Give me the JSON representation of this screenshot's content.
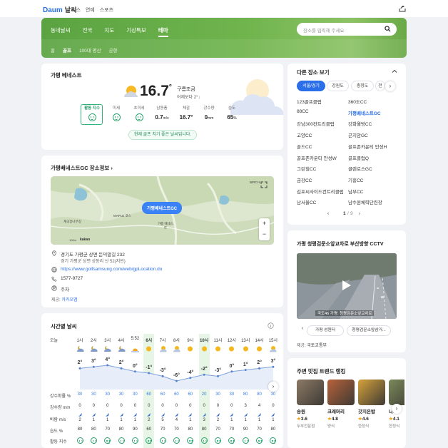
{
  "header": {
    "logo": "Daum",
    "service": "날씨",
    "nav": [
      "뉴스",
      "연예",
      "스포츠"
    ]
  },
  "hero": {
    "tabs": [
      "동네날씨",
      "전국",
      "지도",
      "기상특보",
      "테마"
    ],
    "active_tab": "테마",
    "subtabs": [
      "홈",
      "골프",
      "100대 명산",
      "공항"
    ],
    "active_subtab": "골프",
    "search_placeholder": "장소를 입력해 주세요"
  },
  "current": {
    "title": "가평 베네스트",
    "temp": "16.7",
    "unit": "°",
    "condition": "구름조금",
    "compare": "어제보다 2°↓",
    "stats": [
      {
        "label": "활동 지수",
        "value": "",
        "face": true
      },
      {
        "label": "미세",
        "value": "",
        "face": true
      },
      {
        "label": "초미세",
        "value": "",
        "face": true
      },
      {
        "label": "남동풍",
        "value": "0.7",
        "unit": "m/s"
      },
      {
        "label": "체감",
        "value": "16.7°",
        "unit": ""
      },
      {
        "label": "강수량",
        "value": "0",
        "unit": "mm"
      },
      {
        "label": "습도",
        "value": "65",
        "unit": "%"
      }
    ],
    "message": "현재 골프 치기 좋은 날씨입니다."
  },
  "place": {
    "title": "가평베네스트GC 장소정보 ›",
    "map_pin": "가평베네스트GC",
    "map_labels": [
      "BIRCH",
      "계곡장나무길",
      "MAPLE 코스",
      "가평 베네스트",
      "100m",
      "kakao"
    ],
    "address": "경기도 가평군 상면 둔덕말길 232",
    "address_old": "경기 가평군 상면 상동리 산 52(지번)",
    "url": "https://www.golfsamsung.com/web/gpLocation.do",
    "phone": "1577-9727",
    "parking": "주차",
    "source_label": "제공:",
    "source": "카카오맵"
  },
  "hourly": {
    "title": "시간별 날씨",
    "day": "오늘",
    "times": [
      "1시",
      "2시",
      "3시",
      "4시",
      "5:52",
      "6시",
      "7시",
      "8시",
      "9시",
      "10시",
      "11시",
      "12시",
      "13시",
      "14시",
      "15시"
    ],
    "icons": [
      "night-cloud",
      "night-cloud",
      "night-cloud",
      "night-cloud",
      "sunrise",
      "sun",
      "sun-cloud",
      "sun-cloud",
      "sun",
      "sun",
      "sun",
      "sun",
      "sun",
      "sun",
      "sun-cloud"
    ],
    "temps": [
      "2°",
      "3°",
      "4°",
      "2°",
      "0°",
      "-1°",
      "-3°",
      "-6°",
      "-4°",
      "-2°",
      "-3°",
      "0°",
      "1°",
      "2°",
      "3°"
    ],
    "temp_values": [
      2,
      3,
      4,
      2,
      0,
      -1,
      -3,
      -6,
      -4,
      -2,
      -3,
      0,
      1,
      2,
      3
    ],
    "row_labels": [
      "강수확률 %",
      "강수량 mm",
      "바람 m/s",
      "습도 %",
      "활동 지수"
    ],
    "precip_prob": [
      "30",
      "30",
      "30",
      "30",
      "30",
      "60",
      "60",
      "60",
      "60",
      "20",
      "30",
      "30",
      "80",
      "80",
      "30"
    ],
    "precip": [
      "0",
      "0",
      "0",
      "0",
      "0",
      "0",
      "0",
      "0",
      "0",
      "0",
      "0",
      "0",
      "3",
      "4",
      "0"
    ],
    "wind": [
      "2",
      "1",
      "1",
      "1",
      "1",
      "2",
      "5",
      "4",
      "1",
      "3",
      "2",
      "1",
      "1",
      "1",
      "1"
    ],
    "humidity": [
      "80",
      "80",
      "70",
      "80",
      "90",
      "60",
      "70",
      "70",
      "80",
      "80",
      "70",
      "70",
      "90",
      "70",
      "80"
    ],
    "highlight_cols": [
      5,
      9
    ]
  },
  "other": {
    "title": "다른 장소 보기",
    "categories": [
      "서울/경기",
      "강원도",
      "충청도",
      "전"
    ],
    "active": "서울/경기",
    "places": [
      [
        "123골프클럽",
        "360도CC"
      ],
      [
        "88CC",
        "가평베네스트GC"
      ],
      [
        "강남300컨트리클럽",
        "강화월방CC"
      ],
      [
        "고양CC",
        "곤지암GC"
      ],
      [
        "골드CC",
        "골프존카운티 안성H"
      ],
      [
        "골프존카운티 안성W",
        "골프클럽Q"
      ],
      [
        "그린힐CC",
        "글렌로스GC"
      ],
      [
        "금강CC",
        "기흥CC"
      ],
      [
        "김포씨사이드컨트리클럽",
        "남부CC"
      ],
      [
        "남서울CC",
        "남수원체력단련장"
      ]
    ],
    "selected": "가평베네스트GC",
    "page": "1",
    "total": "9"
  },
  "cctv": {
    "title": "가평 청평검문소앞교차로 부산방향 CCTV",
    "overlay": "국도46 가평: 청평검문소앞교차로",
    "chips": [
      "가평 성원터",
      "청평검문소앞삼거..."
    ],
    "source_label": "제공:",
    "source": "국토교통부"
  },
  "restaurants": {
    "title": "주변 맛집 트렌드 랭킹",
    "items": [
      {
        "name": "송원",
        "rating": "3.6",
        "category": "두부전문점"
      },
      {
        "name": "크래머리",
        "rating": "4.8",
        "category": "양식"
      },
      {
        "name": "갓지은밥",
        "rating": "4.6",
        "category": "한정식"
      },
      {
        "name": "나...",
        "rating": "4.1",
        "category": "한정식"
      }
    ]
  },
  "colors": {
    "hero": "#6fb44d",
    "accent": "#2b6fe8",
    "good": "#2aa46e"
  }
}
